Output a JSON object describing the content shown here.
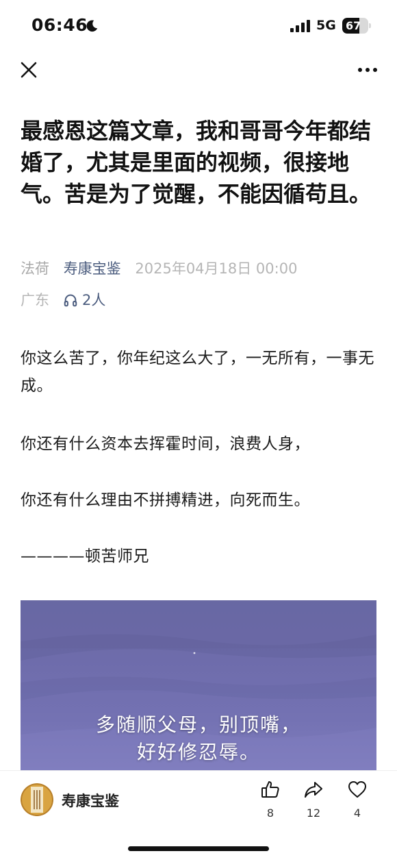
{
  "status_bar": {
    "time": "06:46",
    "network": "5G",
    "battery_level": 67,
    "battery_text": "67",
    "icons": [
      "moon-icon",
      "signal-icon"
    ]
  },
  "nav": {
    "close_icon": "close-icon",
    "more_icon": "more-icon"
  },
  "article": {
    "title": "最感恩这篇文章，我和哥哥今年都结婚了，尤其是里面的视频，很接地气。苦是为了觉醒，不能因循苟且。",
    "category": "法荷",
    "author": "寿康宝鉴",
    "date": "2025年04月18日 00:00",
    "location": "广东",
    "listeners": "2人",
    "paragraphs": [
      "你这么苦了，你年纪这么大了，一无所有，一事无成。",
      "你还有什么资本去挥霍时间，浪费人身，",
      "你还有什么理由不拼搏精进，向死而生。",
      "————顿苦师兄"
    ],
    "video_caption_line1": "多随顺父母，别顶嘴，",
    "video_caption_line2": "好好修忍辱。"
  },
  "bottom_bar": {
    "channel_name": "寿康宝鉴",
    "like_count": "8",
    "share_count": "12",
    "favorite_count": "4"
  },
  "colors": {
    "link_blue": "#4b5c7e",
    "video_purple": "#6e6cab",
    "meta_gray": "#b5b5b5"
  }
}
